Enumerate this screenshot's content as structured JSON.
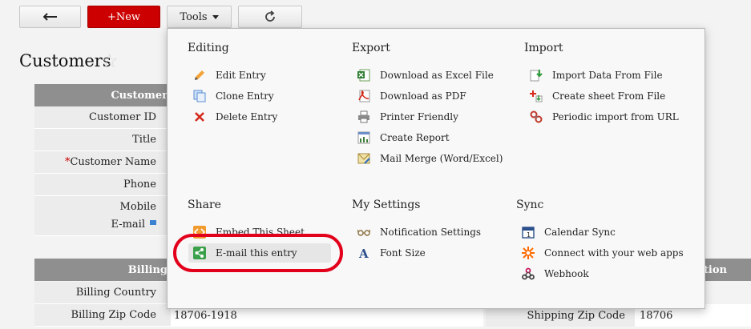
{
  "toolbar": {
    "new_label": "+New",
    "tools_label": "Tools"
  },
  "page": {
    "title": "Customers"
  },
  "form": {
    "section_customer": "Customer",
    "fields": [
      {
        "label": "Customer ID",
        "required": false
      },
      {
        "label": "Title",
        "required": false
      },
      {
        "label": "Customer Name",
        "required": true
      },
      {
        "label": "Phone",
        "required": false
      },
      {
        "label": "Mobile",
        "required": false
      },
      {
        "label": "E-mail",
        "required": false
      }
    ],
    "section_billing": "Billing",
    "billing_country_label": "Billing Country",
    "billing_zip_label": "Billing Zip Code",
    "billing_zip_value": "18706-1918",
    "section_shipping": "ation",
    "shipping_zip_label": "Shipping Zip Code",
    "shipping_zip_value": "18706"
  },
  "menu": {
    "editing": {
      "title": "Editing",
      "items": [
        {
          "label": "Edit Entry",
          "icon": "pencil-icon"
        },
        {
          "label": "Clone Entry",
          "icon": "clone-icon"
        },
        {
          "label": "Delete Entry",
          "icon": "delete-x-icon"
        }
      ]
    },
    "export": {
      "title": "Export",
      "items": [
        {
          "label": "Download as Excel File",
          "icon": "excel-icon"
        },
        {
          "label": "Download as PDF",
          "icon": "pdf-icon"
        },
        {
          "label": "Printer Friendly",
          "icon": "printer-icon"
        },
        {
          "label": "Create Report",
          "icon": "report-icon"
        },
        {
          "label": "Mail Merge (Word/Excel)",
          "icon": "mail-merge-icon"
        }
      ]
    },
    "import": {
      "title": "Import",
      "items": [
        {
          "label": "Import Data From File",
          "icon": "import-file-icon"
        },
        {
          "label": "Create sheet From File",
          "icon": "create-sheet-icon"
        },
        {
          "label": "Periodic import from URL",
          "icon": "link-icon"
        }
      ]
    },
    "share": {
      "title": "Share",
      "items": [
        {
          "label": "Embed This Sheet",
          "icon": "embed-icon"
        },
        {
          "label": "E-mail this entry",
          "icon": "share-icon"
        }
      ]
    },
    "my_settings": {
      "title": "My Settings",
      "items": [
        {
          "label": "Notification Settings",
          "icon": "glasses-icon"
        },
        {
          "label": "Font Size",
          "icon": "font-size-icon"
        }
      ]
    },
    "sync": {
      "title": "Sync",
      "items": [
        {
          "label": "Calendar Sync",
          "icon": "calendar-icon"
        },
        {
          "label": "Connect with your web apps",
          "icon": "connect-icon"
        },
        {
          "label": "Webhook",
          "icon": "webhook-icon"
        }
      ]
    }
  },
  "colors": {
    "new_button": "#cc0000",
    "highlight_ring": "#e3001b",
    "section_header": "#8f8f8f"
  }
}
